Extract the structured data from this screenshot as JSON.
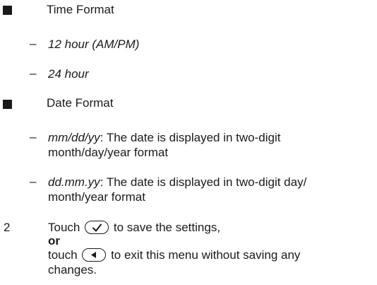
{
  "time_format": {
    "heading": "Time Format",
    "options": [
      "12 hour (AM/PM)",
      "24 hour"
    ]
  },
  "date_format": {
    "heading": "Date Format",
    "opt1_term": "mm/dd/yy",
    "opt1_desc_a": ": The date is displayed in two-digit",
    "opt1_desc_b": "month/day/year format",
    "opt2_term": "dd.mm.yy",
    "opt2_desc_a": ": The date is displayed in two-digit day/",
    "opt2_desc_b": "month/year format"
  },
  "step": {
    "number": "2",
    "touch1": "Touch",
    "after_check": "to save the settings,",
    "or": "or",
    "touch2": "touch",
    "after_back": "to exit this menu without saving any",
    "changes": "changes."
  },
  "dash": "–",
  "icons": {
    "check": "check-icon",
    "back": "back-arrow-icon"
  }
}
